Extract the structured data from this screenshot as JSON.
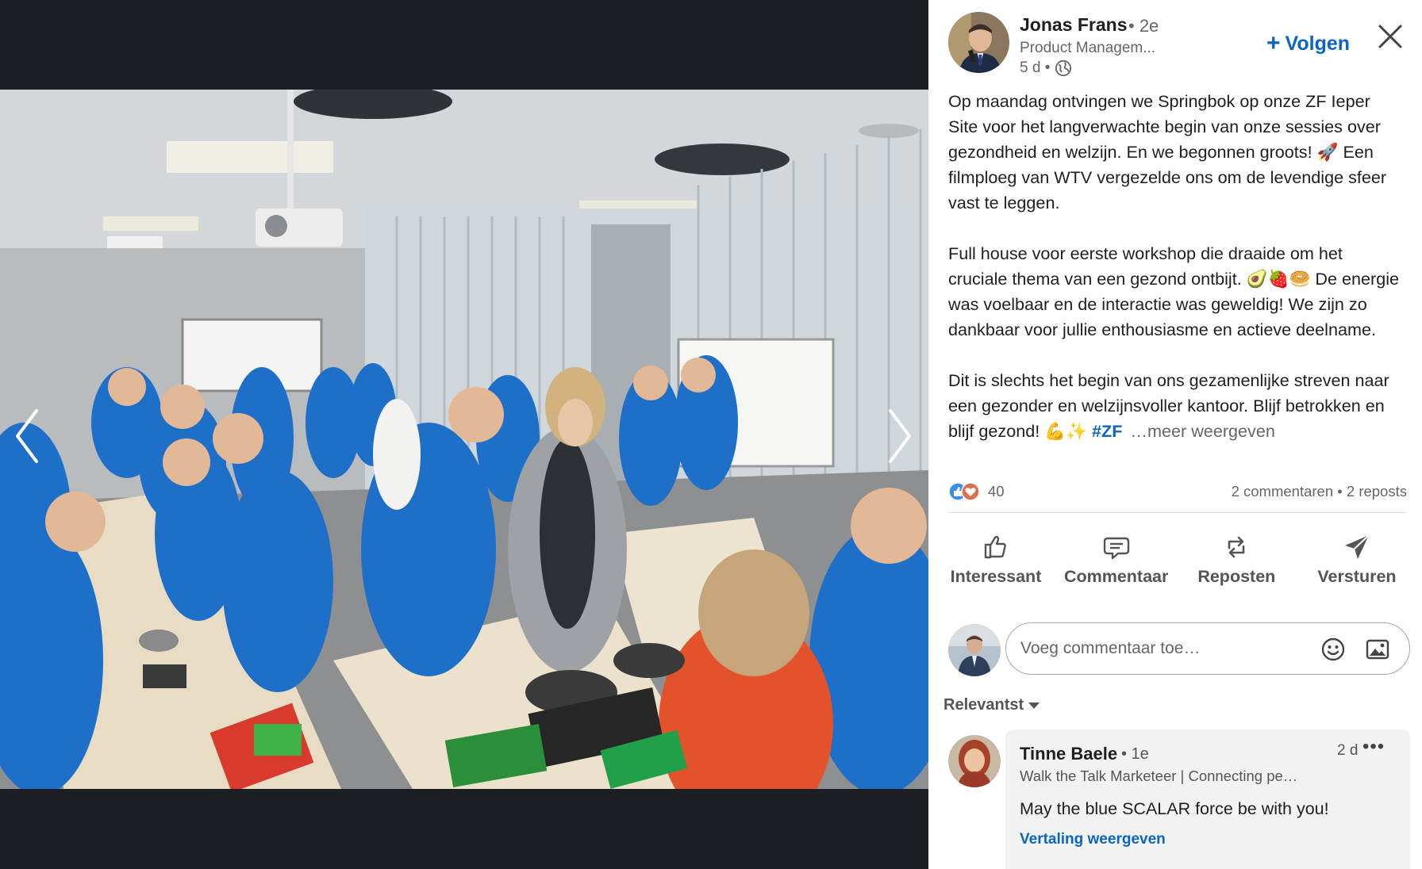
{
  "post": {
    "author_name": "Jonas Frans",
    "author_degree": "• 2e",
    "author_headline": "Product Managem...",
    "timestamp": "5 d •",
    "follow_label": "Volgen",
    "paragraphs": [
      "Op maandag ontvingen we Springbok op onze ZF Ieper Site voor het langverwachte begin van onze sessies over gezondheid en welzijn. En we begonnen groots! 🚀 Een filmploeg van WTV vergezelde ons om de levendige sfeer vast te leggen.",
      "Full house voor eerste workshop die draaide om het cruciale thema van een gezond ontbijt. 🥑🍓🥯 De energie was voelbaar en de interactie was geweldig! We zijn zo dankbaar voor jullie enthousiasme en actieve deelname.",
      "Dit is slechts het begin van ons gezamenlijke streven naar een gezonder en welzijnsvoller kantoor. Blijf betrokken en blijf gezond! 💪✨"
    ],
    "hashtag": "#ZF",
    "see_more": "…meer weergeven"
  },
  "social": {
    "reaction_count": "40",
    "comments_label": "2 commentaren",
    "separator": "•",
    "reposts_label": "2 reposts"
  },
  "actions": {
    "like": "Interessant",
    "comment": "Commentaar",
    "repost": "Reposten",
    "send": "Versturen"
  },
  "comment_box": {
    "placeholder": "Voeg commentaar toe…"
  },
  "sort": {
    "label": "Relevantst"
  },
  "comments": [
    {
      "author": "Tinne Baele",
      "degree": "• 1e",
      "time": "2 d",
      "more": "•••",
      "headline": "Walk the Talk Marketeer | Connecting pe…",
      "text": "May the blue SCALAR force be with you!",
      "translate": "Vertaling weergeven"
    }
  ],
  "colors": {
    "link_blue": "#0a66c2",
    "viewer_bg": "#1b1f23",
    "hoodie_blue": "#1e6fc8"
  },
  "icons": {
    "prev": "chevron-left-icon",
    "next": "chevron-right-icon",
    "close": "close-icon",
    "globe": "globe-icon",
    "like": "thumbs-up-icon",
    "comment": "speech-bubble-icon",
    "repost": "repost-icon",
    "send": "paper-plane-icon",
    "emoji": "smiley-icon",
    "image": "image-icon"
  }
}
